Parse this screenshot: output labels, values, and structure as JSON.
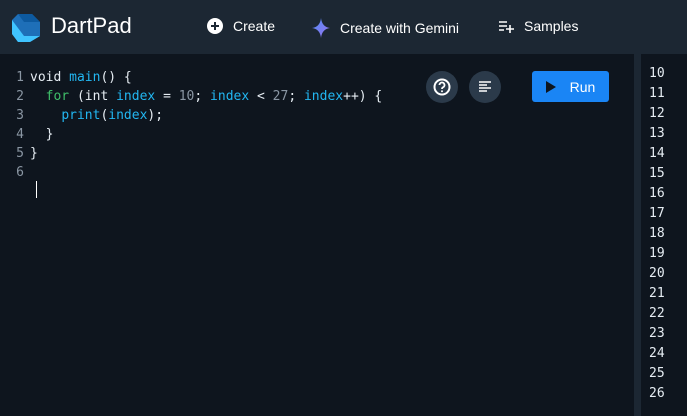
{
  "header": {
    "title": "DartPad",
    "nav": [
      {
        "label": "Create",
        "icon": "add-circle-icon"
      },
      {
        "label": "Create with Gemini",
        "icon": "gemini-sparkle-icon"
      },
      {
        "label": "Samples",
        "icon": "playlist-add-icon"
      }
    ]
  },
  "editor": {
    "lines": [
      [
        {
          "t": "void ",
          "c": "kw"
        },
        {
          "t": "main",
          "c": "fn"
        },
        {
          "t": "() {",
          "c": "pl"
        }
      ],
      [
        {
          "t": "  for",
          "c": "ctl"
        },
        {
          "t": " (int ",
          "c": "pl"
        },
        {
          "t": "index",
          "c": "fn"
        },
        {
          "t": " = ",
          "c": "pl"
        },
        {
          "t": "10",
          "c": "num"
        },
        {
          "t": "; ",
          "c": "pl"
        },
        {
          "t": "index",
          "c": "fn"
        },
        {
          "t": " < ",
          "c": "pl"
        },
        {
          "t": "27",
          "c": "num"
        },
        {
          "t": "; ",
          "c": "pl"
        },
        {
          "t": "index",
          "c": "fn"
        },
        {
          "t": "++) {",
          "c": "pl"
        }
      ],
      [
        {
          "t": "    ",
          "c": "pl"
        },
        {
          "t": "print",
          "c": "fn"
        },
        {
          "t": "(",
          "c": "pl"
        },
        {
          "t": "index",
          "c": "fn"
        },
        {
          "t": ");",
          "c": "pl"
        }
      ],
      [
        {
          "t": "  }",
          "c": "pl"
        }
      ],
      [
        {
          "t": "}",
          "c": "pl"
        }
      ],
      []
    ],
    "run_label": "Run"
  },
  "output": [
    "10",
    "11",
    "12",
    "13",
    "14",
    "15",
    "16",
    "17",
    "18",
    "19",
    "20",
    "21",
    "22",
    "23",
    "24",
    "25",
    "26"
  ]
}
